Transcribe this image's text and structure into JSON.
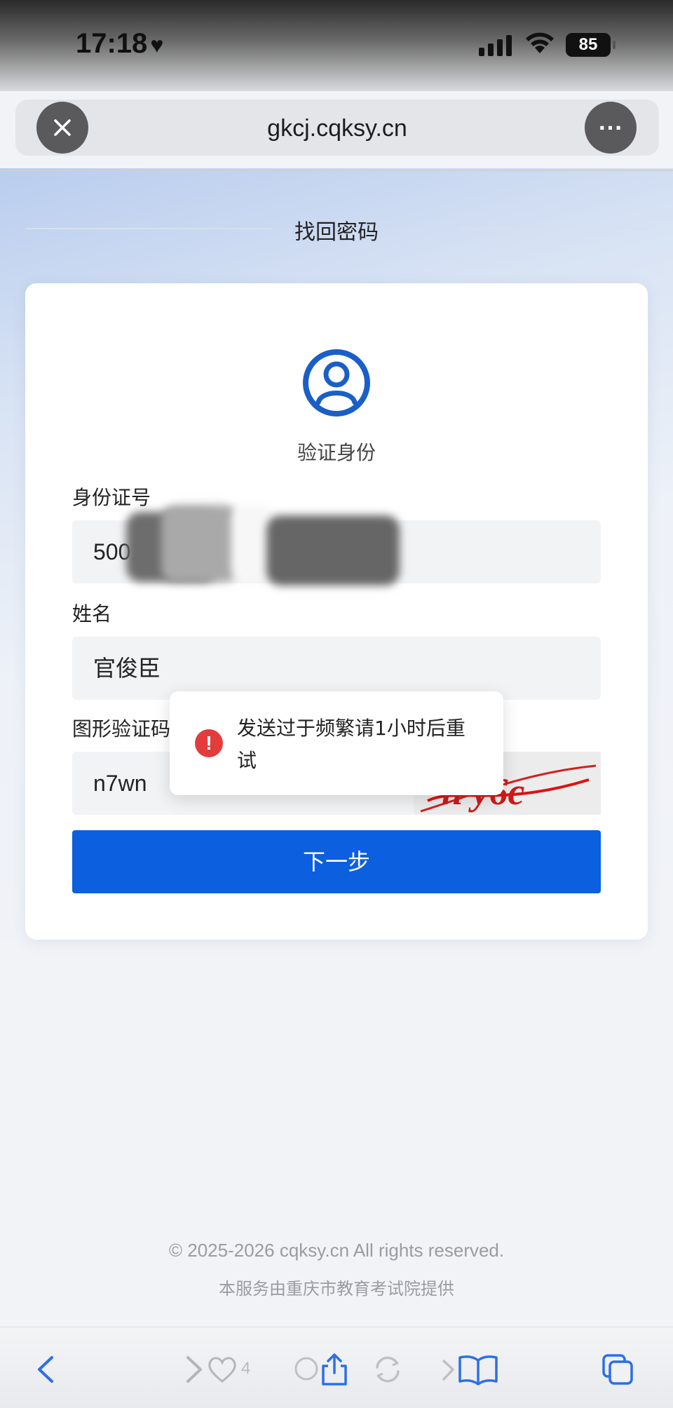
{
  "status_bar": {
    "time": "17:18",
    "heart_icon": "heart-icon",
    "battery_level": "85"
  },
  "browser": {
    "url": "gkcj.cqksy.cn",
    "close_icon": "close-icon",
    "more_icon": "more-icon",
    "more_label": "···"
  },
  "page": {
    "title": "找回密码",
    "card": {
      "heading": "验证身份",
      "id_label": "身份证号",
      "id_value": "5001",
      "name_label": "姓名",
      "name_value": "官俊臣",
      "captcha_label": "图形验证码",
      "captcha_value": "n7wn",
      "captcha_image_text": "n y6c",
      "next_button": "下一步"
    },
    "toast": {
      "message": "发送过于频繁请1小时后重试",
      "icon": "!"
    },
    "footer": {
      "copyright": "© 2025-2026 cqksy.cn All rights reserved.",
      "provider": "本服务由重庆市教育考试院提供"
    }
  },
  "bottom_toolbar": {
    "like_count": "4"
  },
  "colors": {
    "primary": "#0c5fde",
    "error": "#e23c3c",
    "avatar": "#1a5fc8"
  }
}
